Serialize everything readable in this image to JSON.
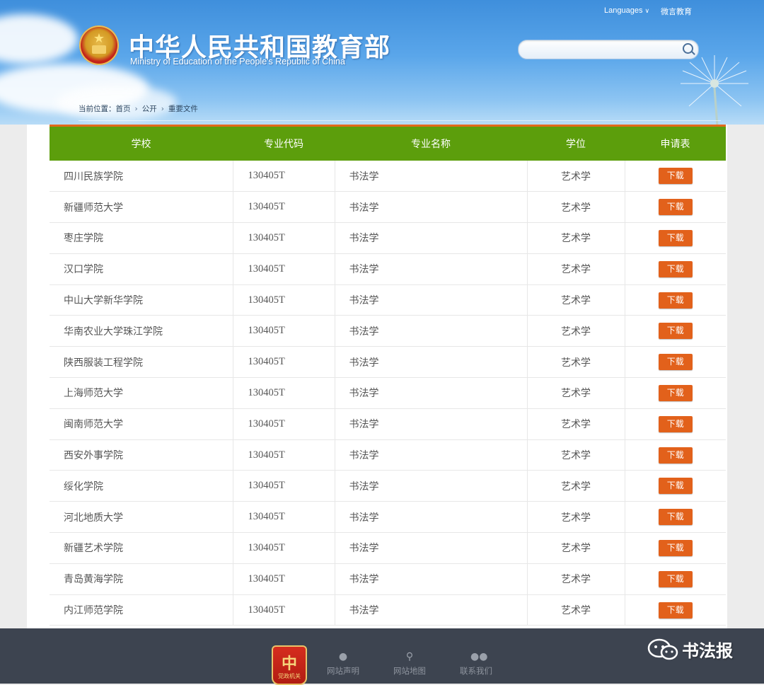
{
  "header": {
    "title_cn": "中华人民共和国教育部",
    "title_en": "Ministry of Education of the People's Republic of China",
    "languages_label": "Languages",
    "weiyan_label": "微言教育",
    "search_placeholder": "",
    "emblem_icon": "national-emblem-icon"
  },
  "breadcrumb": {
    "prefix": "当前位置：",
    "items": [
      "首页",
      "公开",
      "重要文件"
    ]
  },
  "table": {
    "headers": [
      "学校",
      "专业代码",
      "专业名称",
      "学位",
      "申请表"
    ],
    "download_label": "下载",
    "rows": [
      {
        "school": "四川民族学院",
        "code": "130405T",
        "major": "书法学",
        "degree": "艺术学"
      },
      {
        "school": "新疆师范大学",
        "code": "130405T",
        "major": "书法学",
        "degree": "艺术学"
      },
      {
        "school": "枣庄学院",
        "code": "130405T",
        "major": "书法学",
        "degree": "艺术学"
      },
      {
        "school": "汉口学院",
        "code": "130405T",
        "major": "书法学",
        "degree": "艺术学"
      },
      {
        "school": "中山大学新华学院",
        "code": "130405T",
        "major": "书法学",
        "degree": "艺术学"
      },
      {
        "school": "华南农业大学珠江学院",
        "code": "130405T",
        "major": "书法学",
        "degree": "艺术学"
      },
      {
        "school": "陕西服装工程学院",
        "code": "130405T",
        "major": "书法学",
        "degree": "艺术学"
      },
      {
        "school": "上海师范大学",
        "code": "130405T",
        "major": "书法学",
        "degree": "艺术学"
      },
      {
        "school": "闽南师范大学",
        "code": "130405T",
        "major": "书法学",
        "degree": "艺术学"
      },
      {
        "school": "西安外事学院",
        "code": "130405T",
        "major": "书法学",
        "degree": "艺术学"
      },
      {
        "school": "绥化学院",
        "code": "130405T",
        "major": "书法学",
        "degree": "艺术学"
      },
      {
        "school": "河北地质大学",
        "code": "130405T",
        "major": "书法学",
        "degree": "艺术学"
      },
      {
        "school": "新疆艺术学院",
        "code": "130405T",
        "major": "书法学",
        "degree": "艺术学"
      },
      {
        "school": "青岛黄海学院",
        "code": "130405T",
        "major": "书法学",
        "degree": "艺术学"
      },
      {
        "school": "内江师范学院",
        "code": "130405T",
        "major": "书法学",
        "degree": "艺术学"
      }
    ]
  },
  "footer": {
    "badge_glyph": "中",
    "badge_label": "党政机关",
    "links": [
      {
        "label": "网站声明",
        "icon": "user-icon"
      },
      {
        "label": "网站地图",
        "icon": "map-pin-icon"
      },
      {
        "label": "联系我们",
        "icon": "contacts-icon"
      }
    ]
  },
  "watermark": {
    "text": "书法报",
    "icon": "wechat-icon"
  },
  "colors": {
    "header_blue": "#4a9ae3",
    "table_header_green": "#5c9e0c",
    "accent_orange": "#e2611b",
    "footer_dark": "#3d4450"
  }
}
